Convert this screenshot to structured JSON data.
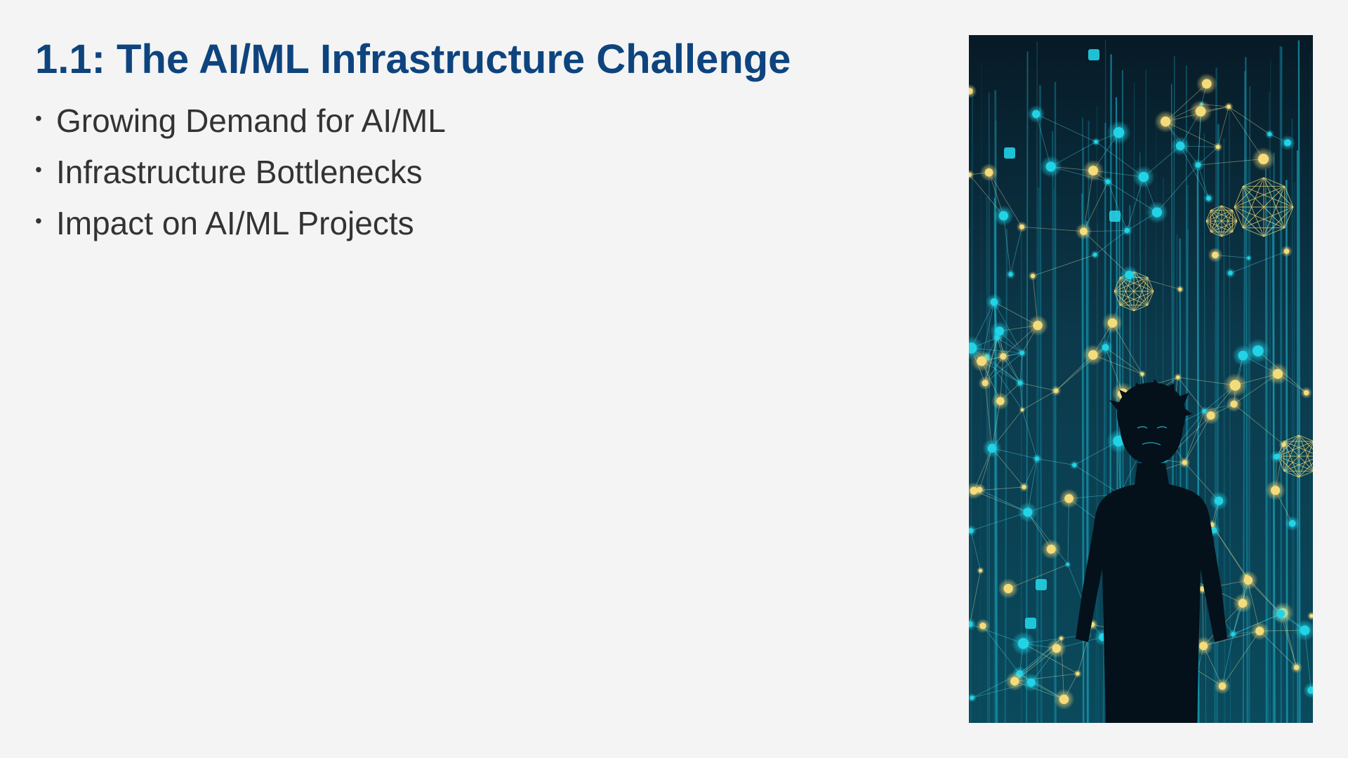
{
  "slide": {
    "title": "1.1: The AI/ML Infrastructure Challenge",
    "bullets": [
      "Growing Demand for AI/ML",
      "Infrastructure Bottlenecks",
      "Impact on AI/ML Projects"
    ],
    "bullet_symbol": "•"
  },
  "colors": {
    "background": "#f4f4f4",
    "title": "#0e447e",
    "body_text": "#333333",
    "image_bg_dark": "#06141e",
    "image_cyan": "#22d3e6",
    "image_gold": "#f5dc7a"
  },
  "illustration": {
    "icon": "network-silhouette-illustration",
    "subject": "person silhouette under glowing neural network"
  }
}
